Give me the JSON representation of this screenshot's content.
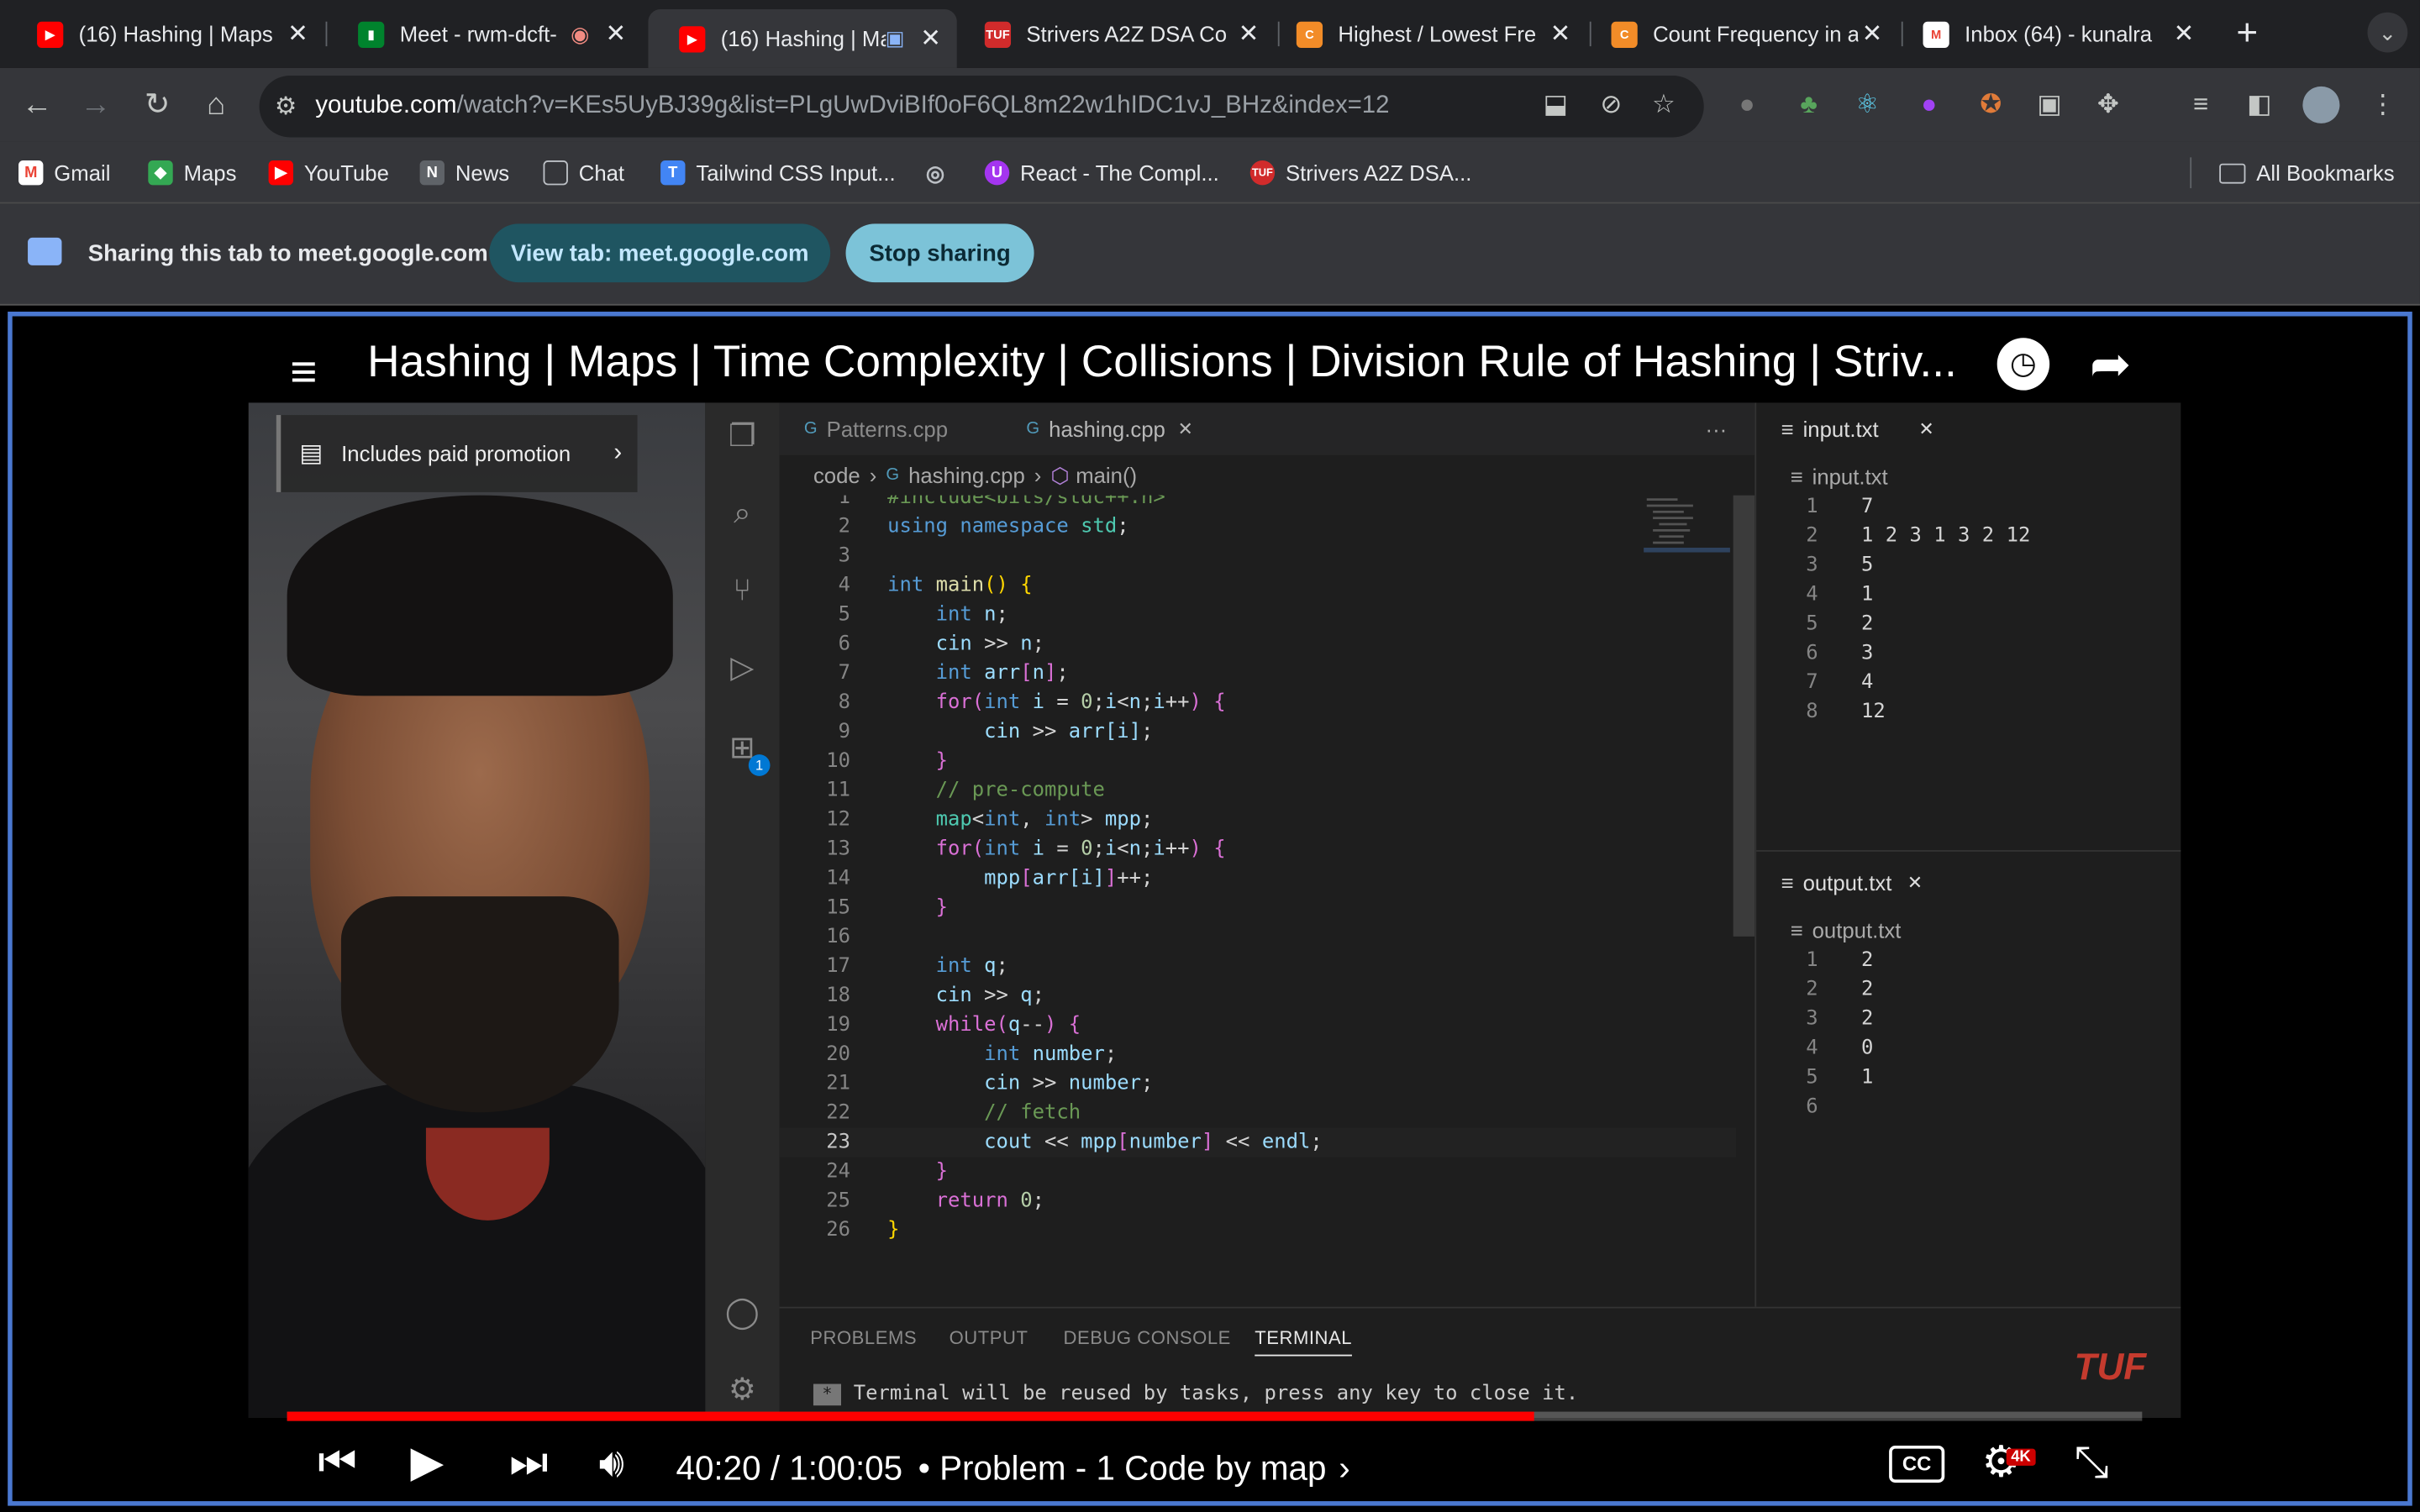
{
  "browser": {
    "tabs": [
      {
        "title": "(16) Hashing | Maps",
        "favicon": "youtube-icon",
        "color": "#ff0000"
      },
      {
        "title": "Meet - rwm-dcft-",
        "favicon": "meet-icon",
        "color": "#00832d"
      },
      {
        "title": "(16) Hashing | Ma",
        "favicon": "youtube-icon",
        "color": "#ff0000"
      },
      {
        "title": "Strivers A2Z DSA Co",
        "favicon": "tuf-icon",
        "color": "#d12b2b"
      },
      {
        "title": "Highest / Lowest Fre",
        "favicon": "codingninjas-icon",
        "color": "#f28c28"
      },
      {
        "title": "Count Frequency in a",
        "favicon": "codingninjas-icon",
        "color": "#f28c28"
      },
      {
        "title": "Inbox (64) - kunalra",
        "favicon": "gmail-icon",
        "color": "#ea4335"
      }
    ],
    "url_domain": "youtube.com",
    "url_path": "/watch?v=KEs5UyBJ39g&list=PLgUwDviBIf0oF6QL8m22w1hIDC1vJ_BHz&index=12",
    "bookmarks": [
      {
        "label": "Gmail",
        "icon": "gmail-icon",
        "color": "#ea4335"
      },
      {
        "label": "Maps",
        "icon": "maps-icon",
        "color": "#34a853"
      },
      {
        "label": "YouTube",
        "icon": "youtube-icon",
        "color": "#ff0000"
      },
      {
        "label": "News",
        "icon": "news-icon",
        "color": "#8ab4f8"
      },
      {
        "label": "Chat",
        "icon": "chat-icon",
        "color": "#bdc1c6"
      },
      {
        "label": "Tailwind CSS Input...",
        "icon": "tailwind-icon",
        "color": "#4285f4"
      },
      {
        "label": "",
        "icon": "globe-icon",
        "color": "#bdc1c6"
      },
      {
        "label": "React - The Compl...",
        "icon": "udemy-icon",
        "color": "#a435f0"
      },
      {
        "label": "Strivers A2Z DSA...",
        "icon": "tuf-icon",
        "color": "#d12b2b"
      }
    ],
    "all_bookmarks": "All Bookmarks"
  },
  "share": {
    "text": "Sharing this tab to meet.google.com",
    "view_tab": "View tab: meet.google.com",
    "stop": "Stop sharing"
  },
  "video": {
    "title": "Hashing | Maps | Time Complexity | Collisions | Division Rule of Hashing | Striv...",
    "promo": "Includes paid promotion",
    "time_current": "40:20",
    "time_total": "1:00:05",
    "chapter": "• Problem - 1 Code by map",
    "progress_fraction": 0.672,
    "brand": "TUF"
  },
  "editor": {
    "tabs": [
      "Patterns.cpp",
      "hashing.cpp"
    ],
    "breadcrumb": [
      "code",
      "hashing.cpp",
      "main()"
    ],
    "code_lines": [
      {
        "n": "1",
        "html": "<span class='c'>#include&lt;bits/stdc++.h&gt;</span>"
      },
      {
        "n": "2",
        "html": "<span class='k'>using</span> <span class='k'>namespace</span> <span class='t'>std</span>;"
      },
      {
        "n": "3",
        "html": ""
      },
      {
        "n": "4",
        "html": "<span class='k'>int</span> <span class='f'>main</span><span class='y'>()</span> <span class='y'>{</span>"
      },
      {
        "n": "5",
        "html": "    <span class='k'>int</span> <span class='v'>n</span>;"
      },
      {
        "n": "6",
        "html": "    <span class='v'>cin</span> &gt;&gt; <span class='v'>n</span>;"
      },
      {
        "n": "7",
        "html": "    <span class='k'>int</span> <span class='v'>arr</span><span class='p'>[</span><span class='v'>n</span><span class='p'>]</span>;"
      },
      {
        "n": "8",
        "html": "    <span class='p'>for</span><span class='p'>(</span><span class='k'>int</span> <span class='v'>i</span> = <span class='n'>0</span>;<span class='v'>i</span>&lt;<span class='v'>n</span>;<span class='v'>i</span>++<span class='p'>)</span> <span class='p'>{</span>"
      },
      {
        "n": "9",
        "html": "        <span class='v'>cin</span> &gt;&gt; <span class='v'>arr</span><span class='v'>[</span><span class='v'>i</span><span class='v'>]</span>;"
      },
      {
        "n": "10",
        "html": "    <span class='p'>}</span>"
      },
      {
        "n": "11",
        "html": "    <span class='c'>// pre-compute</span>"
      },
      {
        "n": "12",
        "html": "    <span class='t'>map</span>&lt;<span class='k'>int</span>, <span class='k'>int</span>&gt; <span class='v'>mpp</span>;"
      },
      {
        "n": "13",
        "html": "    <span class='p'>for</span><span class='p'>(</span><span class='k'>int</span> <span class='v'>i</span> = <span class='n'>0</span>;<span class='v'>i</span>&lt;<span class='v'>n</span>;<span class='v'>i</span>++<span class='p'>)</span> <span class='p'>{</span>"
      },
      {
        "n": "14",
        "html": "        <span class='v'>mpp</span><span class='p'>[</span><span class='v'>arr</span><span class='v'>[</span><span class='v'>i</span><span class='v'>]</span><span class='p'>]</span>++;"
      },
      {
        "n": "15",
        "html": "    <span class='p'>}</span>"
      },
      {
        "n": "16",
        "html": ""
      },
      {
        "n": "17",
        "html": "    <span class='k'>int</span> <span class='v'>q</span>;"
      },
      {
        "n": "18",
        "html": "    <span class='v'>cin</span> &gt;&gt; <span class='v'>q</span>;"
      },
      {
        "n": "19",
        "html": "    <span class='p'>while</span><span class='p'>(</span><span class='v'>q</span>--<span class='p'>)</span> <span class='p'>{</span>"
      },
      {
        "n": "20",
        "html": "        <span class='k'>int</span> <span class='v'>number</span>;"
      },
      {
        "n": "21",
        "html": "        <span class='v'>cin</span> &gt;&gt; <span class='v'>number</span>;"
      },
      {
        "n": "22",
        "html": "        <span class='c'>// fetch</span>"
      },
      {
        "n": "23",
        "html": "        <span class='v'>cout</span> &lt;&lt; <span class='v'>mpp</span><span class='p'>[</span><span class='v'>number</span><span class='p'>]</span> &lt;&lt; <span class='v'>endl</span>;"
      },
      {
        "n": "24",
        "html": "    <span class='p'>}</span>"
      },
      {
        "n": "25",
        "html": "    <span class='p'>return</span> <span class='n'>0</span>;"
      },
      {
        "n": "26",
        "html": "<span class='y'>}</span>"
      }
    ],
    "current_line": 23,
    "input_file": "input.txt",
    "input_lines": [
      "7",
      "1 2 3 1 3 2 12",
      "5",
      "1",
      "2",
      "3",
      "4",
      "12"
    ],
    "output_file": "output.txt",
    "output_lines": [
      "2",
      "2",
      "2",
      "0",
      "1",
      ""
    ],
    "panel_tabs": [
      "PROBLEMS",
      "OUTPUT",
      "DEBUG CONSOLE",
      "TERMINAL"
    ],
    "terminal_text": "Terminal will be reused by tasks, press any key to close it.",
    "extensions_badge": "1"
  }
}
